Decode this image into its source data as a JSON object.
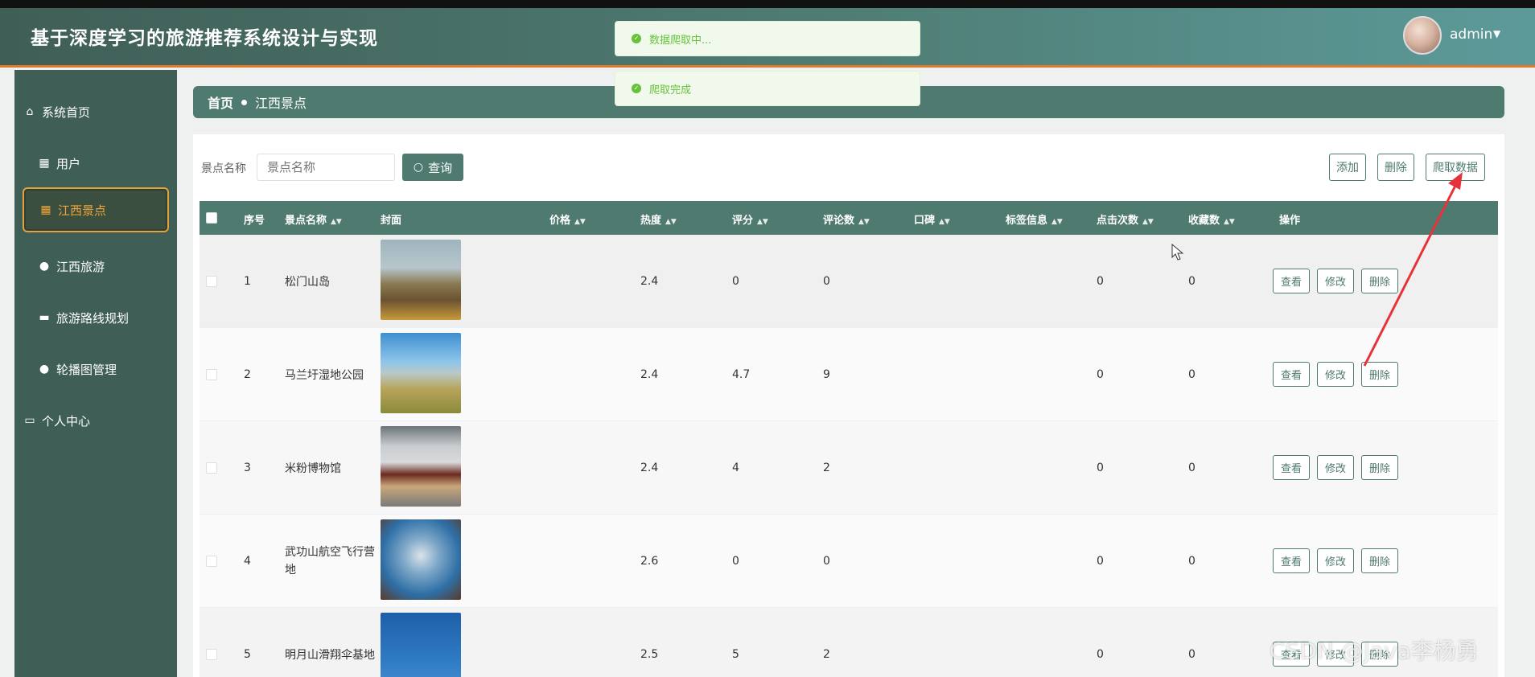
{
  "header": {
    "title": "基于深度学习的旅游推荐系统设计与实现",
    "user": "admin"
  },
  "sidebar": {
    "items": [
      {
        "label": "系统首页",
        "icon": "home-icon"
      },
      {
        "label": "用户",
        "icon": "grid-icon"
      },
      {
        "label": "江西景点",
        "icon": "grid-icon",
        "active": true
      },
      {
        "label": "江西旅游",
        "icon": "person-icon"
      },
      {
        "label": "旅游路线规划",
        "icon": "chat-icon"
      },
      {
        "label": "轮播图管理",
        "icon": "person-icon"
      },
      {
        "label": "个人中心",
        "icon": "card-icon"
      }
    ]
  },
  "breadcrumb": {
    "home": "首页",
    "current": "江西景点"
  },
  "search": {
    "label": "景点名称",
    "placeholder": "景点名称",
    "button": "查询"
  },
  "toolbar": {
    "add": "添加",
    "delete": "删除",
    "crawl": "爬取数据"
  },
  "toasts": [
    "数据爬取中...",
    "爬取完成"
  ],
  "table": {
    "columns": [
      "序号",
      "景点名称",
      "封面",
      "价格",
      "热度",
      "评分",
      "评论数",
      "口碑",
      "标签信息",
      "点击次数",
      "收藏数",
      "操作"
    ],
    "rows": [
      {
        "index": "1",
        "name": "松门山岛",
        "heat": "2.4",
        "score": "0",
        "comments": "0",
        "clicks": "0",
        "favorites": "0"
      },
      {
        "index": "2",
        "name": "马兰圩湿地公园",
        "heat": "2.4",
        "score": "4.7",
        "comments": "9",
        "clicks": "0",
        "favorites": "0"
      },
      {
        "index": "3",
        "name": "米粉博物馆",
        "heat": "2.4",
        "score": "4",
        "comments": "2",
        "clicks": "0",
        "favorites": "0"
      },
      {
        "index": "4",
        "name": "武功山航空飞行营地",
        "heat": "2.6",
        "score": "0",
        "comments": "0",
        "clicks": "0",
        "favorites": "0"
      },
      {
        "index": "5",
        "name": "明月山滑翔伞基地",
        "heat": "2.5",
        "score": "5",
        "comments": "2",
        "clicks": "0",
        "favorites": "0"
      }
    ],
    "actions": {
      "view": "查看",
      "edit": "修改",
      "delete": "删除"
    }
  },
  "watermark": "CSDN @Java李杨勇",
  "colors": {
    "primary": "#4f7a70",
    "sidebar": "#3f5e56",
    "accent": "#e5a23a",
    "success": "#67c23a",
    "arrow": "#e8323a"
  }
}
